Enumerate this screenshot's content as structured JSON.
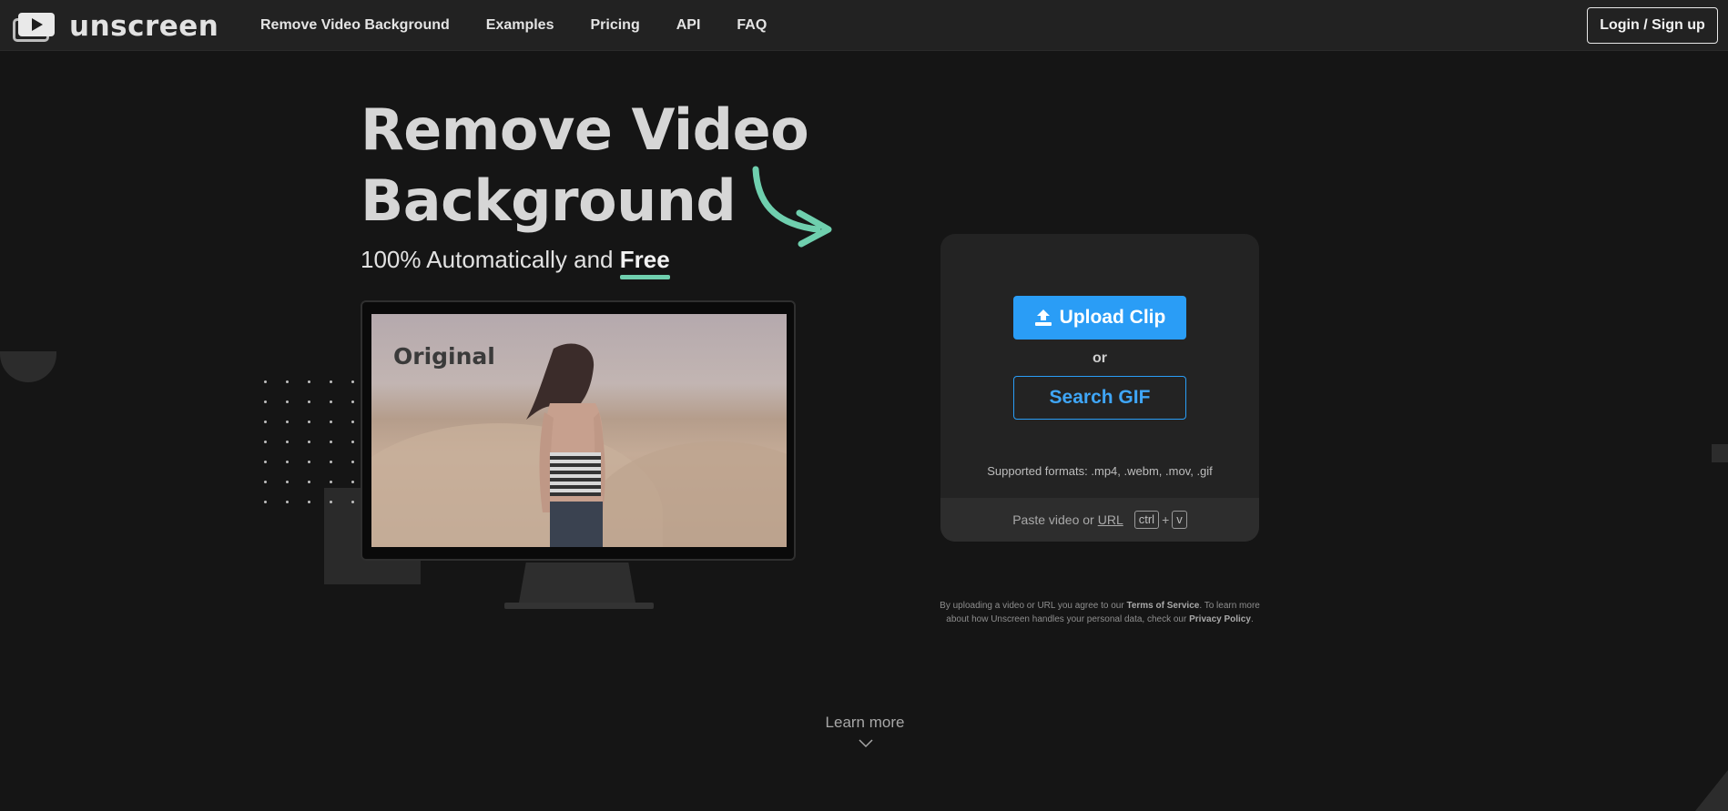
{
  "brand": {
    "name": "unscreen"
  },
  "nav": {
    "links": [
      "Remove Video Background",
      "Examples",
      "Pricing",
      "API",
      "FAQ"
    ],
    "login_label": "Login / Sign up"
  },
  "hero": {
    "title_line1": "Remove Video",
    "title_line2": "Background",
    "subtitle_prefix": "100% Automatically and ",
    "subtitle_emphasis": "Free"
  },
  "preview": {
    "label": "Original"
  },
  "upload_card": {
    "upload_label": "Upload Clip",
    "or_label": "or",
    "search_label": "Search GIF",
    "formats": "Supported formats: .mp4, .webm, .mov, .gif",
    "paste_prefix": "Paste video or",
    "paste_url": "URL",
    "key_ctrl": "ctrl",
    "key_plus": "+",
    "key_v": "v"
  },
  "legal": {
    "part1": "By uploading a video or URL you agree to our ",
    "terms": "Terms of Service",
    "part2": ". To learn more about how Unscreen handles your personal data, check our ",
    "privacy": "Privacy Policy",
    "part3": "."
  },
  "learn_more": {
    "label": "Learn more"
  },
  "colors": {
    "background": "#151515",
    "navbar": "#222222",
    "accent_blue": "#2a9df6",
    "accent_green": "#6fcfae",
    "card": "#232323"
  },
  "icons": [
    "play-icon",
    "upload-icon",
    "curved-arrow-icon",
    "chevron-down-icon"
  ]
}
